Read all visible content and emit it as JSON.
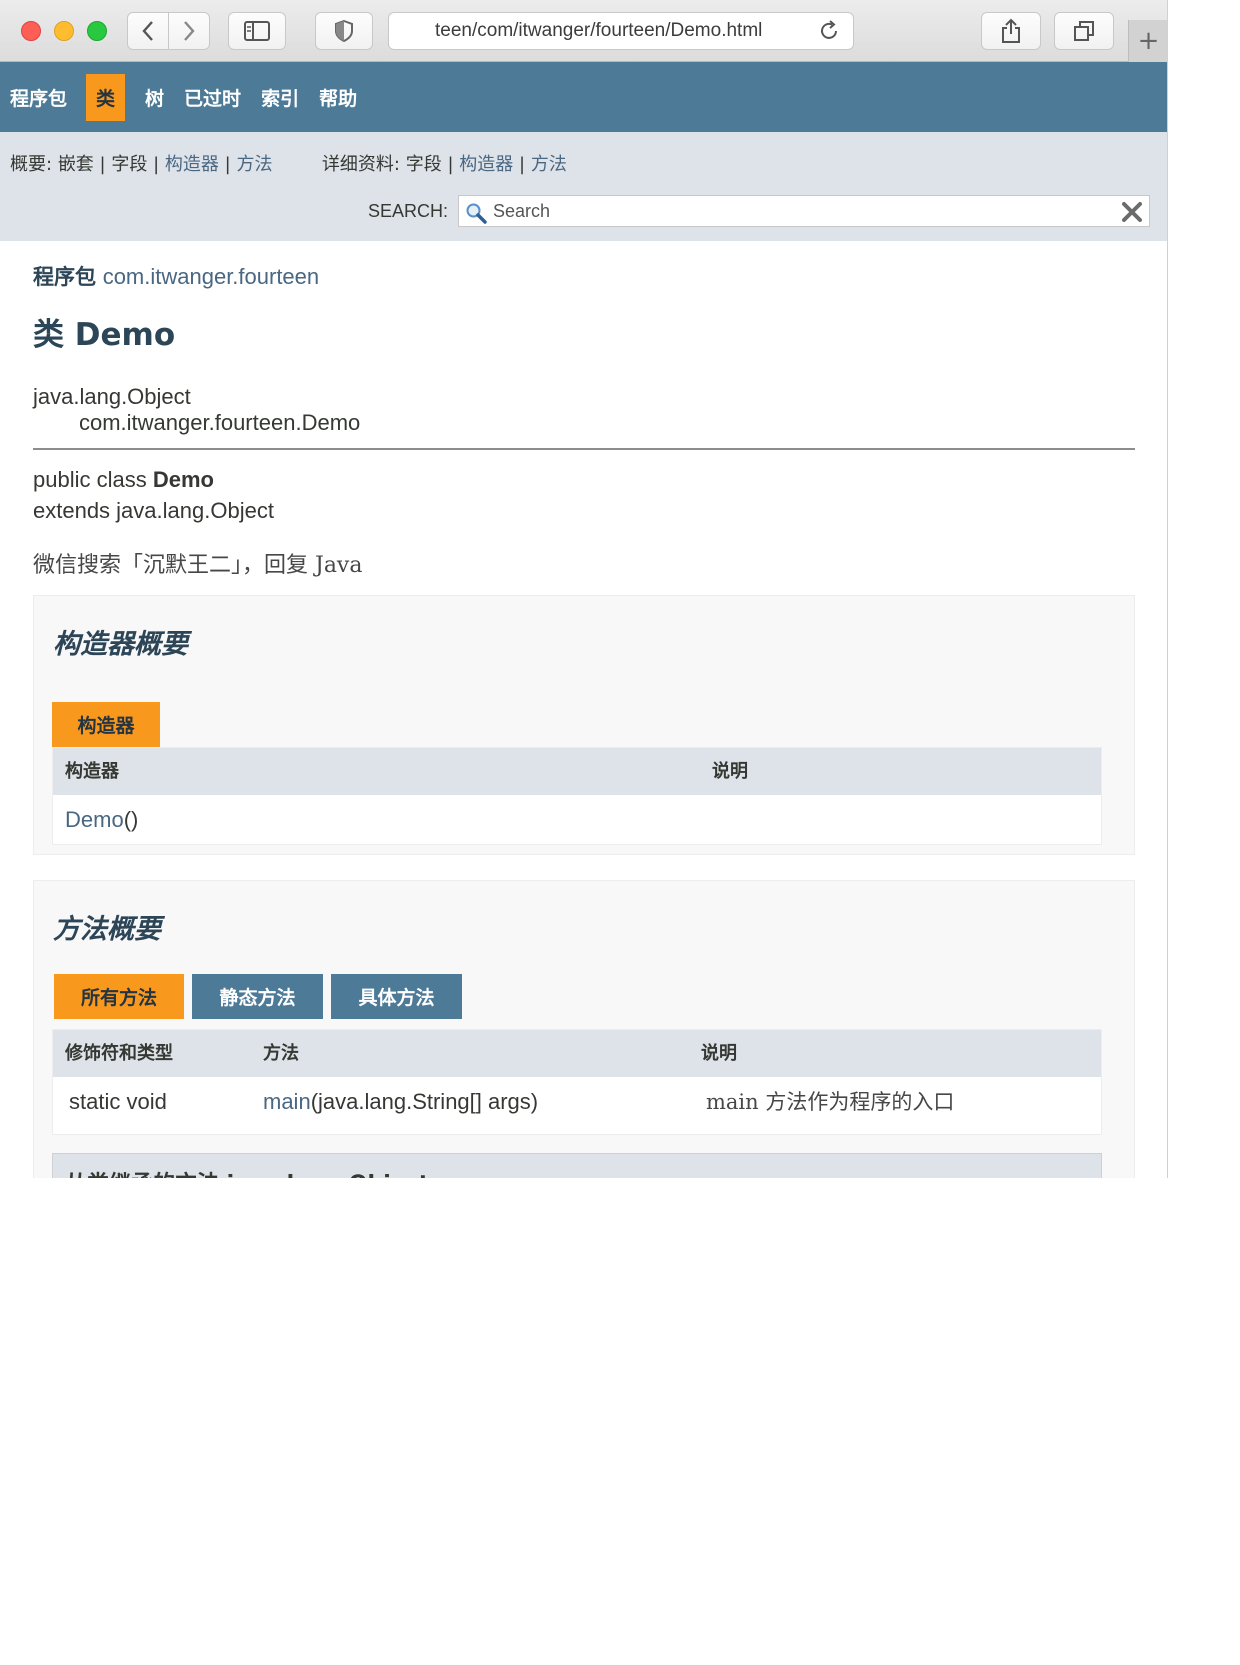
{
  "browser": {
    "url": "teen/com/itwanger/fourteen/Demo.html"
  },
  "topnav": {
    "items": [
      "程序包",
      "类",
      "树",
      "已过时",
      "索引",
      "帮助"
    ],
    "active_index": 1
  },
  "subnav": {
    "summary_label": "概要:",
    "summary_nested": "嵌套",
    "summary_field": "字段",
    "summary_constructor": "构造器",
    "summary_method": "方法",
    "detail_label": "详细资料:",
    "detail_field": "字段",
    "detail_constructor": "构造器",
    "detail_method": "方法",
    "separator": "|",
    "search_label": "SEARCH:",
    "search_placeholder": "Search"
  },
  "header": {
    "package_label": "程序包",
    "package_name": "com.itwanger.fourteen",
    "class_title": "类 Demo"
  },
  "inheritance": {
    "parent": "java.lang.Object",
    "child": "com.itwanger.fourteen.Demo"
  },
  "declaration": {
    "line1_prefix": "public class ",
    "line1_name": "Demo",
    "line2": "extends java.lang.Object"
  },
  "description": "微信搜索「沉默王二」，回复 Java",
  "constructor_summary": {
    "title": "构造器概要",
    "tab": "构造器",
    "columns": [
      "构造器",
      "说明"
    ],
    "rows": [
      {
        "name": "Demo",
        "suffix": "()",
        "desc": ""
      }
    ]
  },
  "method_summary": {
    "title": "方法概要",
    "tabs": [
      "所有方法",
      "静态方法",
      "具体方法"
    ],
    "columns": [
      "修饰符和类型",
      "方法",
      "说明"
    ],
    "rows": [
      {
        "modifier": "static void",
        "name": "main",
        "params": "(java.lang.String[] args)",
        "desc": "main 方法作为程序的入口"
      }
    ],
    "inherited_heading": "从类继承的方法 java.lang.Object"
  },
  "colors": {
    "nav_bg": "#4d7a97",
    "active_tab": "#f8981d",
    "subnav_bg": "#dee3e9",
    "link": "#4a6782"
  }
}
